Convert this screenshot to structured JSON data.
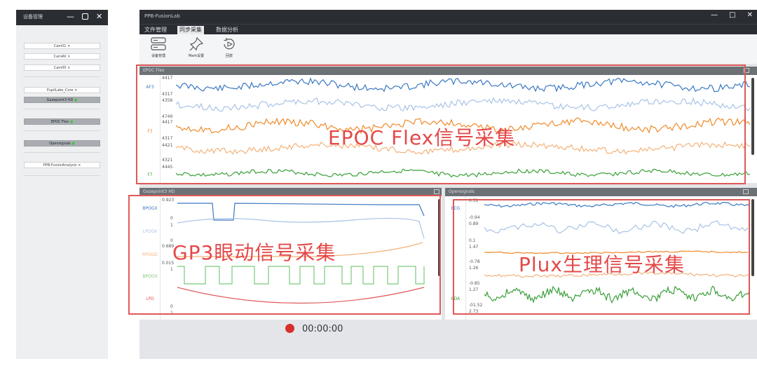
{
  "device_panel": {
    "title": "设备管理",
    "items": [
      "Cam01 ×",
      "CamAV ×",
      "Cam00 ×",
      "PupilLabs_Core ×",
      "Gazepoint3 HD",
      "EPOC Flex",
      "Opensignals",
      "PPB-FusionAnalysis ×"
    ]
  },
  "window": {
    "title": "PPB-FusionLab",
    "menu": [
      "文件管理",
      "同步采集",
      "数据分析"
    ],
    "tools": [
      "设备管理",
      "Mark设置",
      "回放"
    ]
  },
  "epoc_panel": {
    "title": "EPOC Flex",
    "channels": [
      "AF3",
      "",
      "F3",
      "",
      "F7"
    ],
    "ticks": [
      "4417",
      "4317",
      "4356",
      "4749",
      "4417",
      "4317",
      "4421",
      "4321",
      "4445"
    ],
    "annotation": "EPOC Flex信号采集"
  },
  "gp3_panel": {
    "title": "Gazepoint3 HD",
    "channels": [
      "BPOGX",
      "LPOGX",
      "RPOGD",
      "BPOGV",
      "LPD"
    ],
    "ticks": [
      "0.923",
      "0",
      "1",
      "0",
      "0.689",
      "0.015",
      "1",
      "0",
      "1"
    ],
    "annotation": "GP3眼动信号采集"
  },
  "plux_panel": {
    "title": "Opensignals",
    "channels": [
      "ECG",
      "",
      "",
      "",
      "EDA"
    ],
    "ticks": [
      "0.51",
      "-0.94",
      "0.89",
      "0.1",
      "1.47",
      "-0.78",
      "1.26",
      "-0.85",
      "1.27",
      "-01.52",
      "2.73"
    ],
    "annotation": "Plux生理信号采集"
  },
  "recording": {
    "time": "00:00:00"
  },
  "colors": {
    "blue": "#3a78c2",
    "lightblue": "#a9c3e6",
    "orange": "#f08a2a",
    "lightorange": "#f4b27a",
    "green": "#3aa03a",
    "red": "#e05858"
  }
}
